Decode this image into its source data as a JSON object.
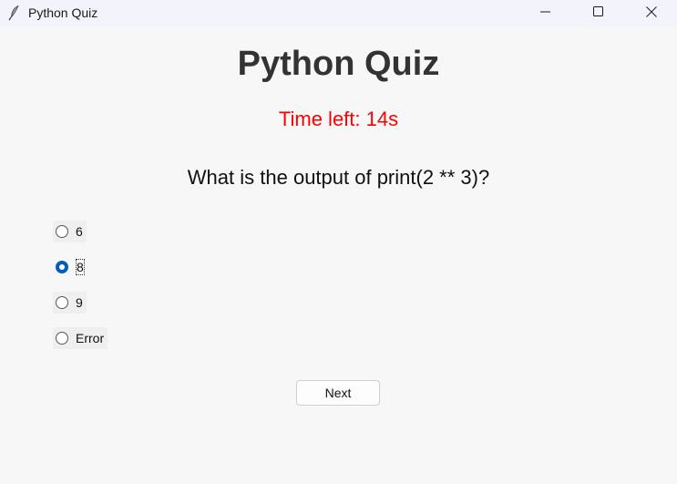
{
  "window": {
    "title": "Python Quiz",
    "icon": "feather-icon"
  },
  "quiz": {
    "title": "Python Quiz",
    "timer_text": "Time left: 14s",
    "timer_color": "#ff0000",
    "question": "What is the output of print(2 ** 3)?",
    "options": [
      {
        "label": "6",
        "selected": false
      },
      {
        "label": "8",
        "selected": true
      },
      {
        "label": "9",
        "selected": false
      },
      {
        "label": "Error",
        "selected": false
      }
    ],
    "next_label": "Next"
  },
  "colors": {
    "accent": "#005fb8",
    "title_text": "#333333",
    "background": "#f7f7f7"
  }
}
